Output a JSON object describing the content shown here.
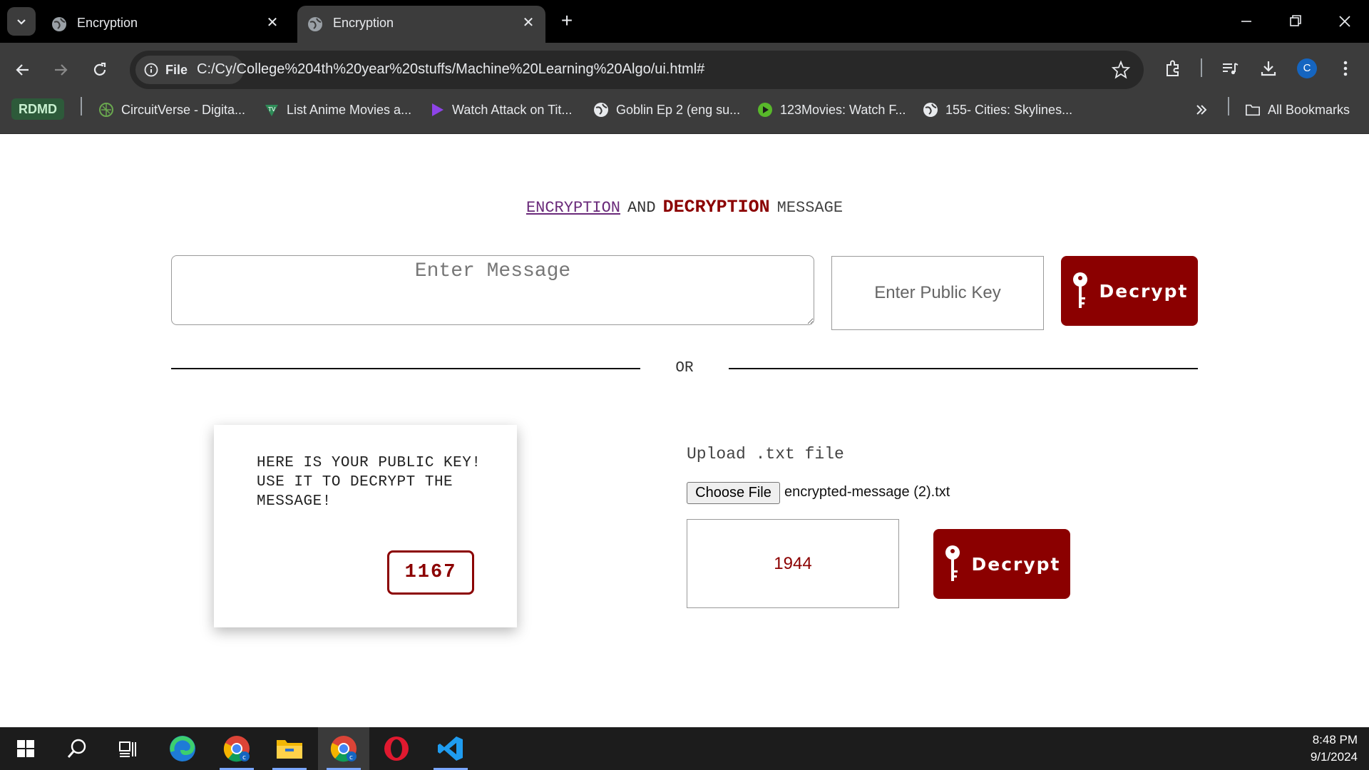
{
  "browser": {
    "tabs": [
      {
        "title": "Encryption",
        "active": false
      },
      {
        "title": "Encryption",
        "active": true
      }
    ],
    "address": {
      "scheme_chip": "File",
      "url": "C:/Cy/College%204th%20year%20stuffs/Machine%20Learning%20Algo/ui.html#"
    },
    "profile_initial": "C",
    "bookmarks": [
      {
        "label": "RDMD",
        "icon": "rdmd-badge"
      },
      {
        "label": "CircuitVerse - Digita...",
        "icon": "circuitverse-icon"
      },
      {
        "label": "List Anime Movies a...",
        "icon": "tv-icon"
      },
      {
        "label": "Watch Attack on Tit...",
        "icon": "play-triangle-icon"
      },
      {
        "label": "Goblin Ep 2 (eng su...",
        "icon": "globe-icon"
      },
      {
        "label": "123Movies: Watch F...",
        "icon": "play-circle-icon"
      },
      {
        "label": "155- Cities: Skylines...",
        "icon": "globe-icon"
      }
    ],
    "all_bookmarks": "All Bookmarks"
  },
  "page": {
    "heading": {
      "encryption": "ENCRYPTION",
      "and": "AND",
      "decryption": "DECRYPTION",
      "message": "MESSAGE"
    },
    "message_input": {
      "placeholder": "Enter Message",
      "value": ""
    },
    "public_key_input": {
      "placeholder": "Enter Public Key",
      "value": ""
    },
    "decrypt_button_top": "Decrypt",
    "divider_text": "OR",
    "public_key_card": {
      "text": "HERE IS YOUR PUBLIC KEY! USE IT TO DECRYPT THE MESSAGE!",
      "key_value": "1167"
    },
    "upload": {
      "label": "Upload .txt file",
      "choose_button": "Choose File",
      "file_name": "encrypted-message (2).txt",
      "key_value": "1944",
      "decrypt_button": "Decrypt"
    }
  },
  "taskbar": {
    "apps": [
      "windows-start-icon",
      "search-icon",
      "task-view-icon",
      "edge-icon",
      "chrome-icon",
      "file-explorer-icon",
      "chrome-icon",
      "opera-icon",
      "vscode-icon"
    ],
    "time": "8:48 PM",
    "date": "9/1/2024"
  },
  "colors": {
    "accent": "#8b0000",
    "link": "#6a2a7a",
    "chrome_bg": "#3c3c3c",
    "tabstrip_bg": "#000000"
  }
}
